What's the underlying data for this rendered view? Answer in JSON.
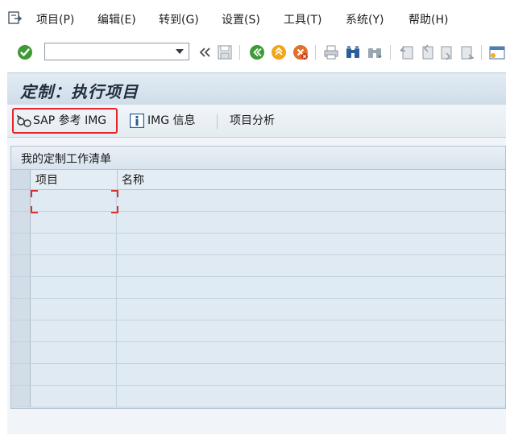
{
  "menu": {
    "items": [
      "项目(P)",
      "编辑(E)",
      "转到(G)",
      "设置(S)",
      "工具(T)",
      "系统(Y)",
      "帮助(H)"
    ]
  },
  "toolbar": {
    "command_field_value": "",
    "icons": [
      "check-icon",
      "back-icon",
      "save-icon",
      "back-green-icon",
      "exit-icon",
      "cancel-icon",
      "print-icon",
      "find-icon",
      "find-next-icon",
      "first-page-icon",
      "prev-page-icon",
      "next-page-icon",
      "last-page-icon",
      "create-session-icon"
    ]
  },
  "title": "定制：执行项目",
  "app_toolbar": {
    "sap_img_label": "SAP 参考 IMG",
    "img_info_label": "IMG 信息",
    "project_analysis_label": "项目分析"
  },
  "table": {
    "title": "我的定制工作清单",
    "columns": [
      "项目",
      "名称"
    ],
    "rows": [
      [
        "",
        ""
      ],
      [
        "",
        ""
      ],
      [
        "",
        ""
      ],
      [
        "",
        ""
      ],
      [
        "",
        ""
      ],
      [
        "",
        ""
      ],
      [
        "",
        ""
      ],
      [
        "",
        ""
      ],
      [
        "",
        ""
      ],
      [
        "",
        ""
      ]
    ]
  },
  "colors": {
    "highlight": "#e4262a",
    "title_bg": "#d8e4ee",
    "grid_bg": "#dfeaf3"
  }
}
